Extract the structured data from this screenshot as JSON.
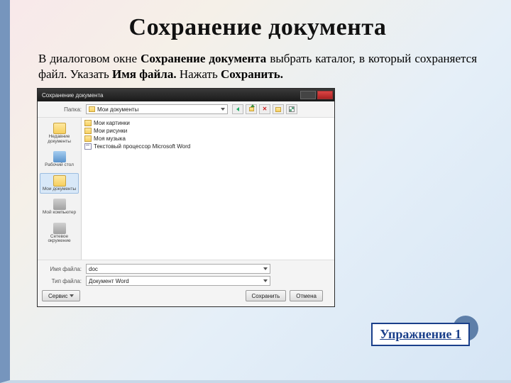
{
  "slide": {
    "title": "Сохранение документа",
    "intro_pre": "В диалоговом окне ",
    "intro_bold1": "Сохранение документа",
    "intro_mid": " выбрать каталог, в который сохраняется файл. Указать ",
    "intro_bold2": "Имя файла.",
    "intro_post": " Нажать ",
    "intro_bold3": "Сохранить."
  },
  "dialog": {
    "titlebar": "Сохранение документа",
    "folder_label": "Папка:",
    "folder_value": "Мои документы",
    "places": [
      "Недавние документы",
      "Рабочий стол",
      "Мои документы",
      "Мой компьютер",
      "Сетевое окружение"
    ],
    "files": [
      {
        "icon": "folder",
        "name": "Мои картинки"
      },
      {
        "icon": "folder",
        "name": "Мои рисунки"
      },
      {
        "icon": "folder",
        "name": "Моя музыка"
      },
      {
        "icon": "doc",
        "name": "Текстовый процессор Microsoft Word"
      }
    ],
    "filename_label": "Имя файла:",
    "filename_value": "doc",
    "filetype_label": "Тип файла:",
    "filetype_value": "Документ Word",
    "tools": "Сервис",
    "save": "Сохранить",
    "cancel": "Отмена"
  },
  "link": {
    "label": "Упражнение 1"
  }
}
